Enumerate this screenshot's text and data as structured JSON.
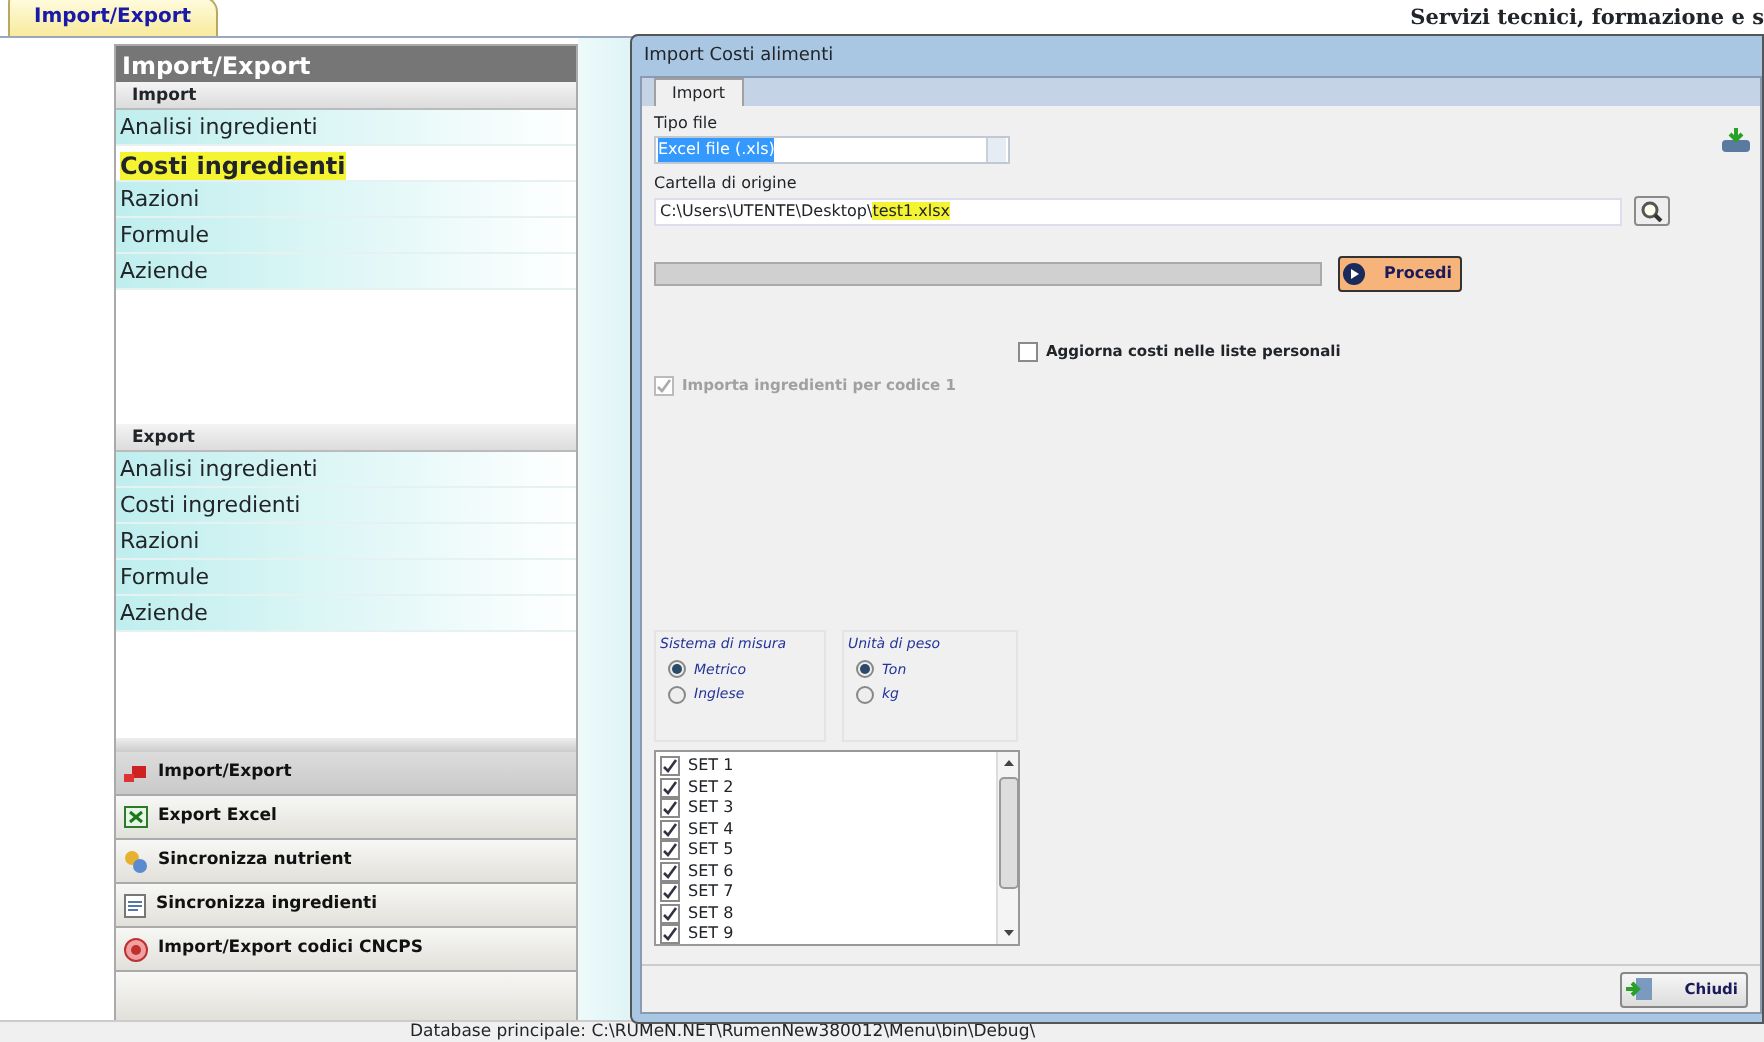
{
  "top_tab": {
    "label": "Import/Export",
    "selected": true
  },
  "header_text": "Servizi tecnici, formazione e s",
  "sidebar": {
    "title": "Import/Export",
    "sections": [
      {
        "title": "Import",
        "items": [
          {
            "label": "Analisi ingredienti",
            "highlighted": false
          },
          {
            "label": "Costi ingredienti",
            "highlighted": true
          },
          {
            "label": "Razioni",
            "highlighted": false
          },
          {
            "label": "Formule",
            "highlighted": false
          },
          {
            "label": "Aziende",
            "highlighted": false
          }
        ]
      },
      {
        "title": "Export",
        "items": [
          {
            "label": "Analisi ingredienti",
            "highlighted": false
          },
          {
            "label": "Costi ingredienti",
            "highlighted": false
          },
          {
            "label": "Razioni",
            "highlighted": false
          },
          {
            "label": "Formule",
            "highlighted": false
          },
          {
            "label": "Aziende",
            "highlighted": false
          }
        ]
      }
    ],
    "nav_buttons": [
      {
        "label": "Import/Export",
        "kind": "import",
        "selected": true
      },
      {
        "label": "Export Excel",
        "kind": "excel",
        "selected": false
      },
      {
        "label": "Sincronizza nutrient",
        "kind": "sync",
        "selected": false
      },
      {
        "label": "Sincronizza ingredienti",
        "kind": "doc",
        "selected": false
      },
      {
        "label": "Import/Export codici CNCPS",
        "kind": "cncps",
        "selected": false
      }
    ]
  },
  "dialog": {
    "title": "Import Costi alimenti",
    "tabs": [
      {
        "label": "Import",
        "selected": true
      }
    ],
    "file_type": {
      "label": "Tipo file",
      "value": "Excel file (.xls)",
      "text_selected": true
    },
    "folder": {
      "label": "Cartella di origine",
      "value_prefix": "C:\\Users\\UTENTE\\Desktop\\",
      "value_highlighted": "test1.xlsx"
    },
    "progress": {
      "level": 0
    },
    "proceed_button": "Procedi",
    "options": [
      {
        "label": "Aggiorna costi nelle liste personali",
        "checked": false,
        "disabled": false
      },
      {
        "label": "Importa ingredienti per codice 1",
        "checked": true,
        "disabled": true
      }
    ],
    "groups": [
      {
        "title": "Sistema di misura",
        "options": [
          {
            "label": "Metrico",
            "selected": true
          },
          {
            "label": "Inglese",
            "selected": false
          }
        ]
      },
      {
        "title": "Unità di peso",
        "options": [
          {
            "label": "Ton",
            "selected": true
          },
          {
            "label": "kg",
            "selected": false
          }
        ]
      }
    ],
    "sets": [
      {
        "label": "SET 1",
        "checked": true
      },
      {
        "label": "SET 2",
        "checked": true
      },
      {
        "label": "SET 3",
        "checked": true
      },
      {
        "label": "SET 4",
        "checked": true
      },
      {
        "label": "SET 5",
        "checked": true
      },
      {
        "label": "SET 6",
        "checked": true
      },
      {
        "label": "SET 7",
        "checked": true
      },
      {
        "label": "SET 8",
        "checked": true
      },
      {
        "label": "SET 9",
        "checked": true
      }
    ],
    "close_button": "Chiudi"
  },
  "status_bar": "Database principale: C:\\RUMeN.NET\\RumenNew380012\\Menu\\bin\\Debug\\"
}
